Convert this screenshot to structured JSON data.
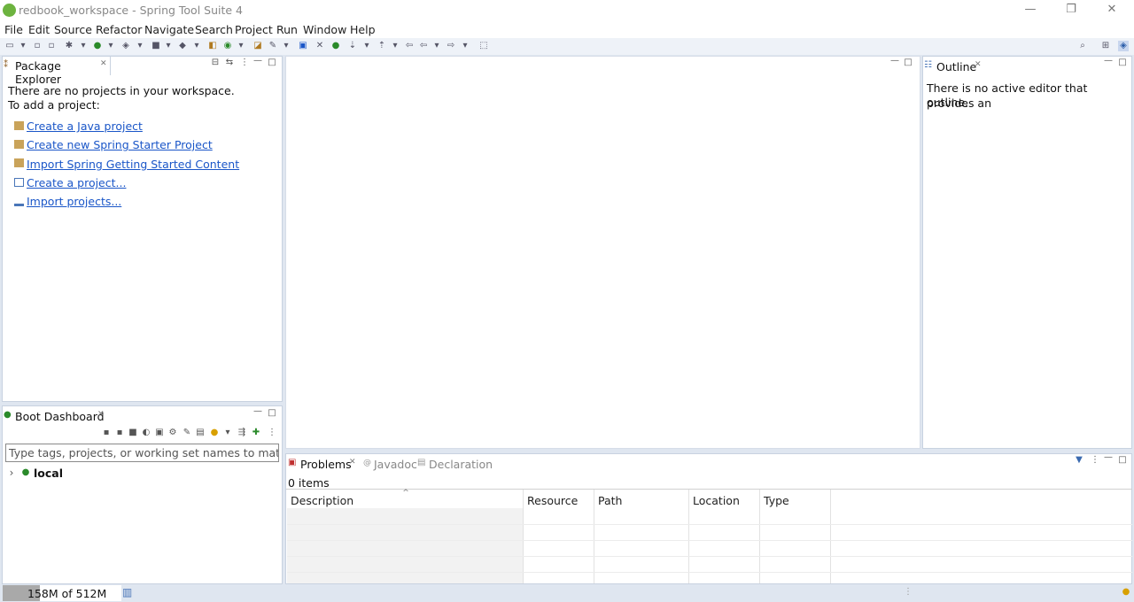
{
  "window": {
    "title": "redbook_workspace - Spring Tool Suite 4",
    "controls": [
      "—",
      "❐",
      "✕"
    ]
  },
  "menu": [
    "File",
    "Edit",
    "Source",
    "Refactor",
    "Navigate",
    "Search",
    "Project",
    "Run",
    "Window",
    "Help"
  ],
  "package_explorer": {
    "tab_label": "Package Explorer",
    "empty_line1": "There are no projects in your workspace.",
    "empty_line2": "To add a project:",
    "links": [
      "Create a Java project",
      "Create new Spring Starter Project",
      "Import Spring Getting Started Content",
      "Create a project...",
      "Import projects..."
    ]
  },
  "boot_dashboard": {
    "tab_label": "Boot Dashboard",
    "filter_placeholder": "Type tags, projects, or working set names to match (incl",
    "tree_item": "local"
  },
  "outline": {
    "tab_label": "Outline",
    "message_line1": "There is no active editor that provides an",
    "message_line2": "outline."
  },
  "bottom_panel": {
    "tabs": [
      "Problems",
      "Javadoc",
      "Declaration"
    ],
    "active_tab": "Problems",
    "items_count": "0 items",
    "columns": [
      "Description",
      "Resource",
      "Path",
      "Location",
      "Type"
    ]
  },
  "status": {
    "heap": "158M of 512M",
    "heap_used_fraction": 0.31
  },
  "colors": {
    "link": "#1a56c8",
    "spring_green": "#6db33f",
    "frame": "#c8d2e0"
  }
}
